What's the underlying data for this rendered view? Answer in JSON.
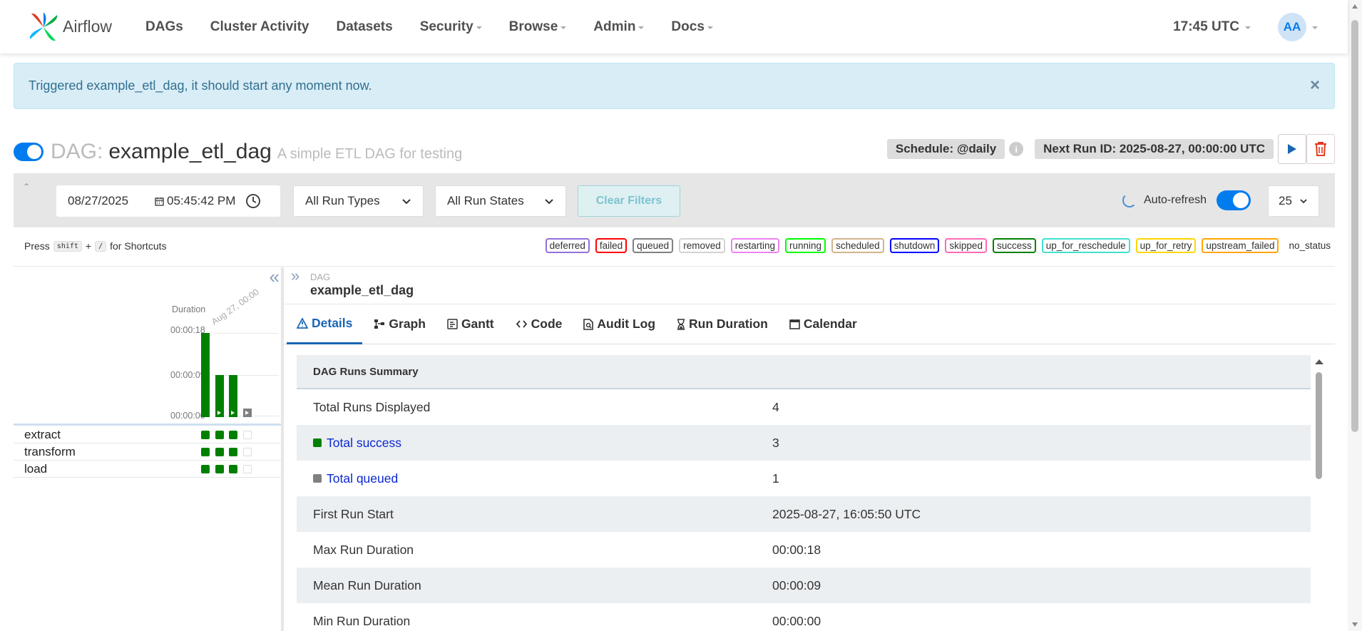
{
  "nav": {
    "brand": "Airflow",
    "items": [
      "DAGs",
      "Cluster Activity",
      "Datasets",
      "Security",
      "Browse",
      "Admin",
      "Docs"
    ],
    "time": "17:45 UTC",
    "avatar": "AA"
  },
  "alert": {
    "message": "Triggered example_etl_dag, it should start any moment now.",
    "close": "×"
  },
  "dag": {
    "prefix": "DAG:",
    "id": "example_etl_dag",
    "description": "A simple ETL DAG for testing",
    "schedule": "Schedule: @daily",
    "next_run": "Next Run ID: 2025-08-27, 00:00:00 UTC",
    "paused": false
  },
  "filters": {
    "date": "08/27/2025",
    "time": "05:45:42 PM",
    "run_types": "All Run Types",
    "run_states": "All Run States",
    "clear": "Clear Filters",
    "auto_refresh": "Auto-refresh",
    "num_runs": "25"
  },
  "shortcuts": {
    "press": "Press",
    "key1": "shift",
    "plus": "+",
    "key2": "/",
    "suffix": "for Shortcuts"
  },
  "states": [
    {
      "name": "deferred",
      "color": "#9370db"
    },
    {
      "name": "failed",
      "color": "#ff0000"
    },
    {
      "name": "queued",
      "color": "#808080"
    },
    {
      "name": "removed",
      "color": "#d3d3d3"
    },
    {
      "name": "restarting",
      "color": "#ee82ee"
    },
    {
      "name": "running",
      "color": "#00ff00"
    },
    {
      "name": "scheduled",
      "color": "#d2b48c"
    },
    {
      "name": "shutdown",
      "color": "#0000ff"
    },
    {
      "name": "skipped",
      "color": "#ff69b4"
    },
    {
      "name": "success",
      "color": "#008000"
    },
    {
      "name": "up_for_reschedule",
      "color": "#40e0d0"
    },
    {
      "name": "up_for_retry",
      "color": "#ffd700"
    },
    {
      "name": "upstream_failed",
      "color": "#ffa500"
    },
    {
      "name": "no_status",
      "color": ""
    }
  ],
  "grid": {
    "duration_label": "Duration",
    "run_date": "Aug 27, 00:00",
    "ticks": [
      "00:00:18",
      "00:00:09",
      "00:00:00"
    ],
    "runs": [
      {
        "duration_s": 18,
        "state": "success"
      },
      {
        "duration_s": 9,
        "state": "success"
      },
      {
        "duration_s": 9,
        "state": "success"
      },
      {
        "duration_s": 1,
        "state": "queued"
      }
    ],
    "tasks": [
      {
        "name": "extract",
        "states": [
          "success",
          "success",
          "success",
          "none"
        ]
      },
      {
        "name": "transform",
        "states": [
          "success",
          "success",
          "success",
          "none"
        ]
      },
      {
        "name": "load",
        "states": [
          "success",
          "success",
          "success",
          "none"
        ]
      }
    ]
  },
  "details": {
    "crumb_label": "DAG",
    "crumb_title": "example_etl_dag",
    "tabs": [
      "Details",
      "Graph",
      "Gantt",
      "Code",
      "Audit Log",
      "Run Duration",
      "Calendar"
    ],
    "summary_title": "DAG Runs Summary",
    "rows": [
      {
        "label": "Total Runs Displayed",
        "value": "4"
      },
      {
        "label": "Total success",
        "value": "3"
      },
      {
        "label": "Total queued",
        "value": "1"
      },
      {
        "label": "First Run Start",
        "value": "2025-08-27, 16:05:50 UTC"
      },
      {
        "label": "Max Run Duration",
        "value": "00:00:18"
      },
      {
        "label": "Mean Run Duration",
        "value": "00:00:09"
      },
      {
        "label": "Min Run Duration",
        "value": "00:00:00"
      }
    ]
  }
}
